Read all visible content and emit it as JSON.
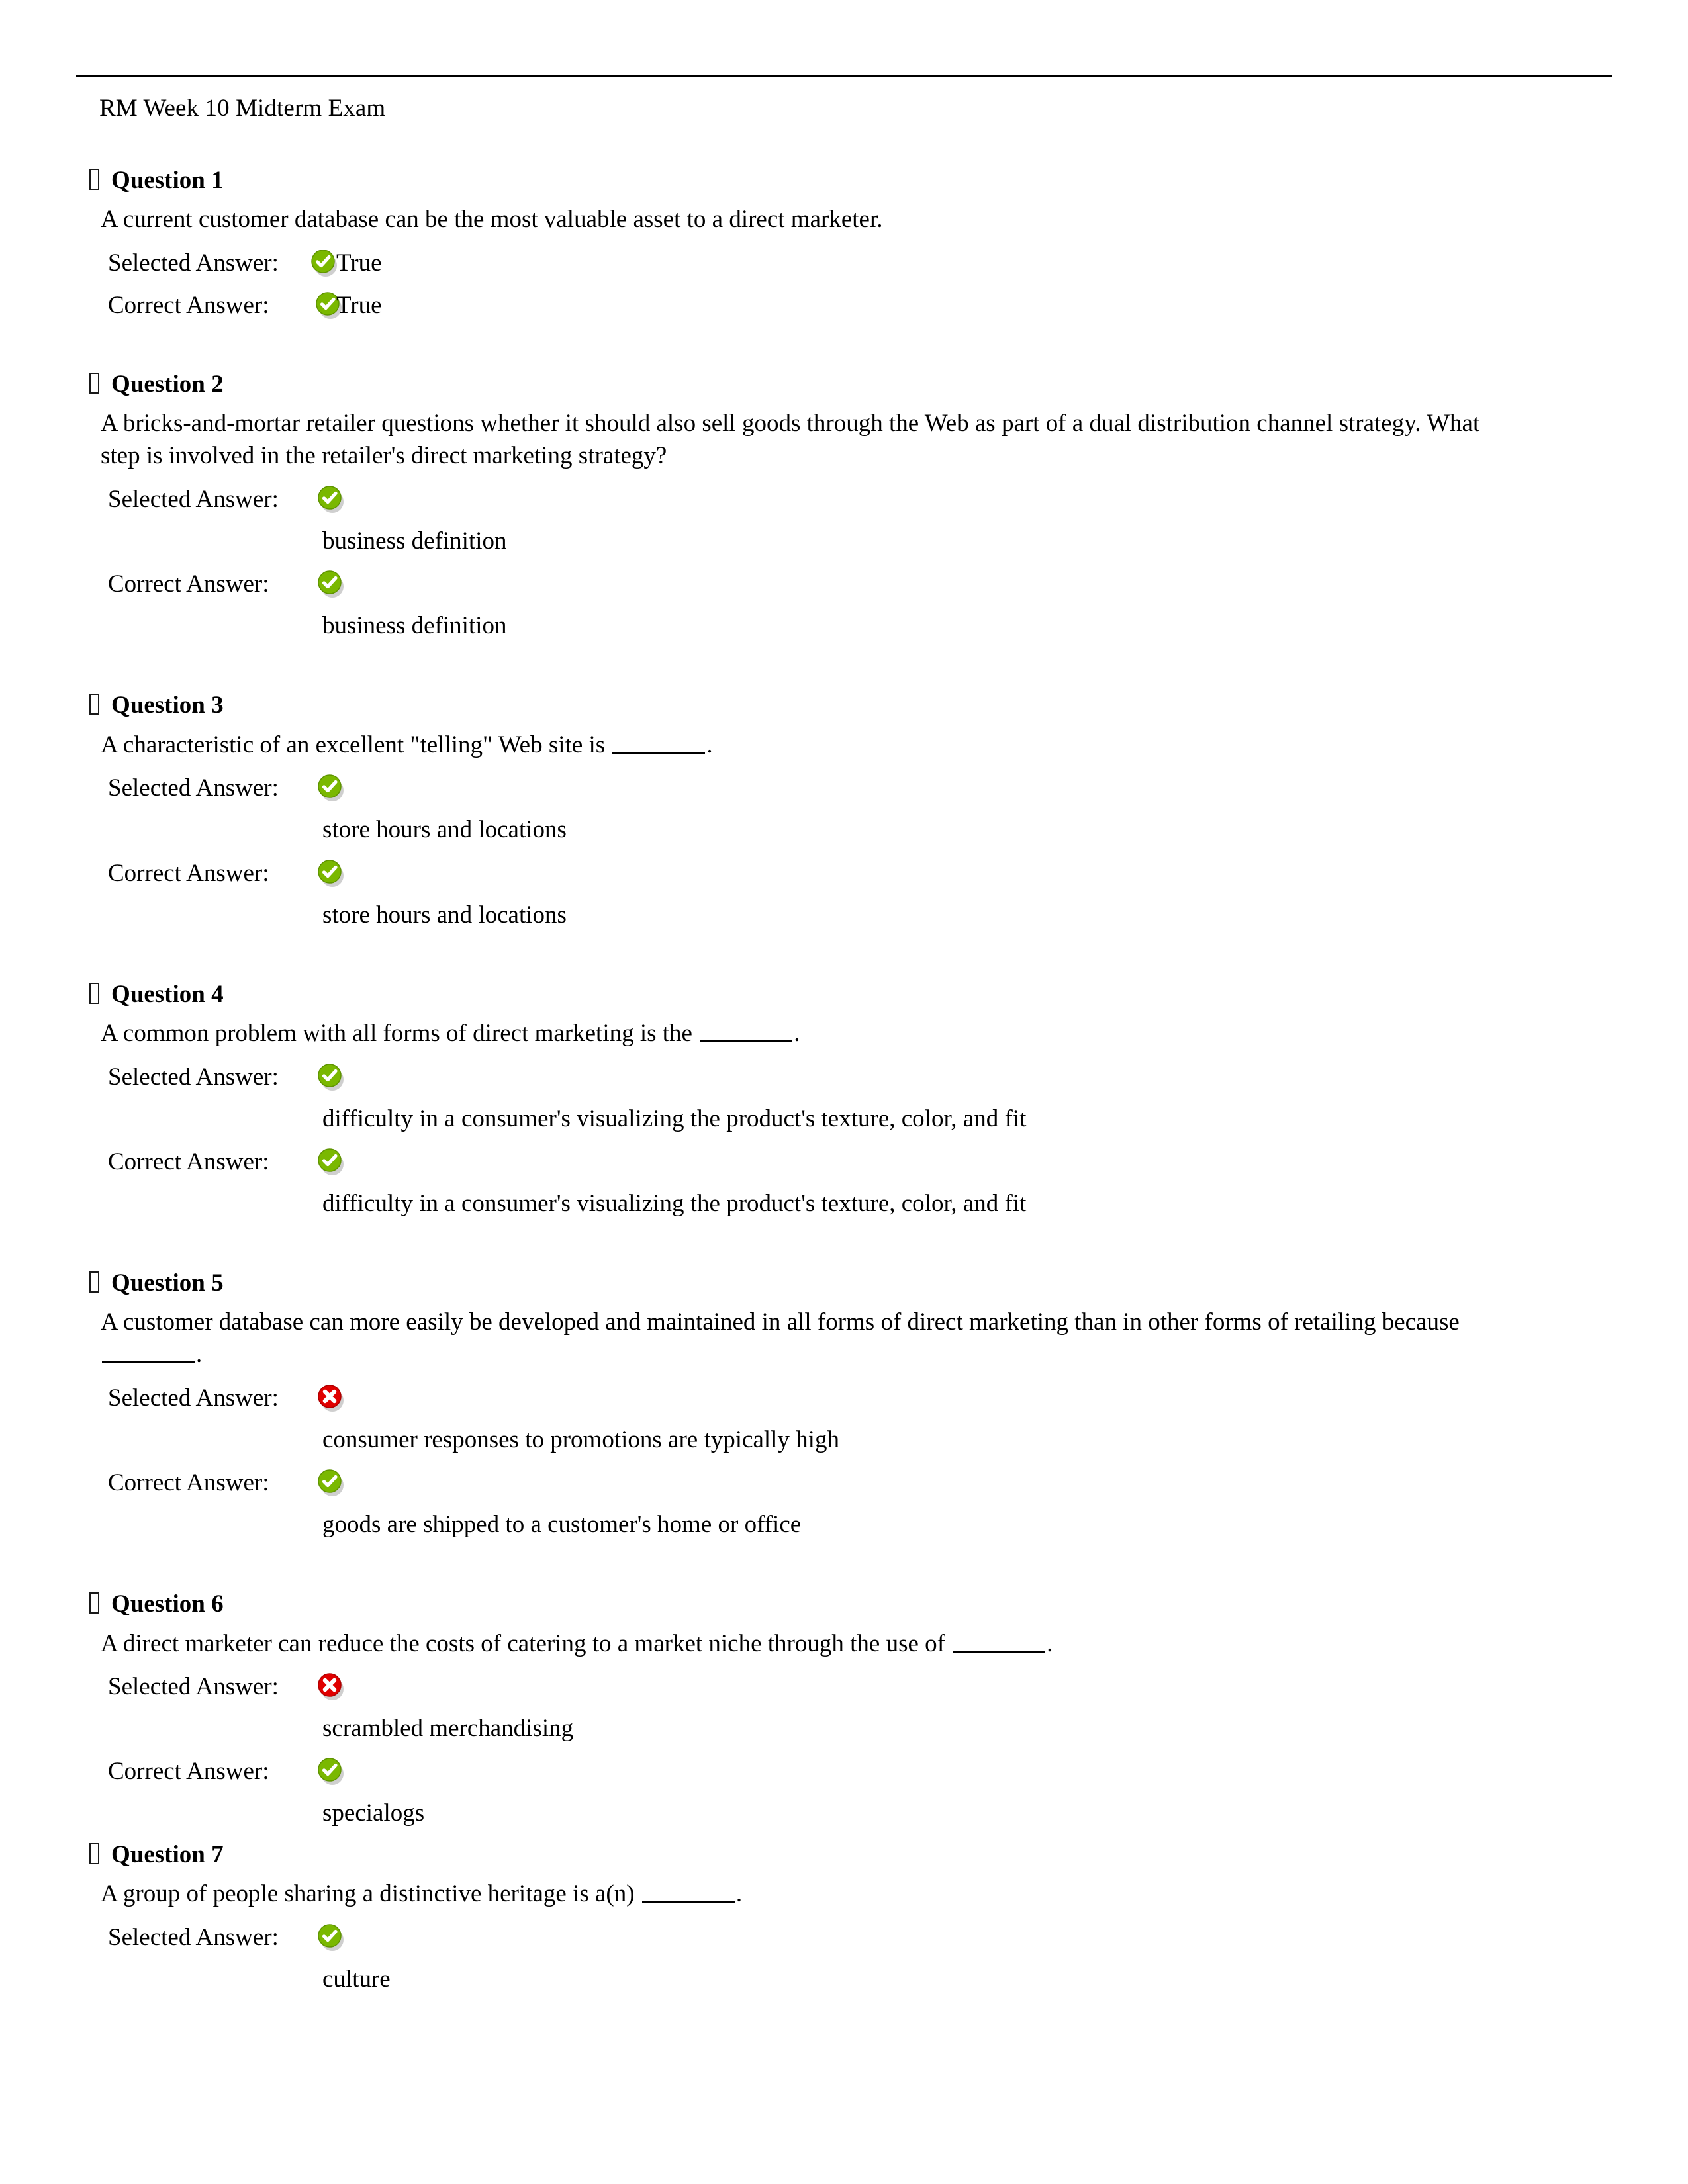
{
  "document": {
    "title": "RM Week 10 Midterm Exam",
    "labels": {
      "selected_answer": "Selected Answer:",
      "correct_answer": "Correct Answer:",
      "question_prefix": "Question"
    },
    "icons": {
      "correct": "green-check-circle-icon",
      "incorrect": "red-x-circle-icon",
      "bullet": "missing-glyph-box-icon"
    },
    "colors": {
      "correct_green": "#7ab800",
      "correct_green_dark": "#5f9400",
      "incorrect_red": "#e00000",
      "incorrect_red_dark": "#b00000",
      "icon_mark": "#ffffff",
      "text": "#000000",
      "rule": "#000000",
      "shadow": "#a8a8a8"
    }
  },
  "questions": [
    {
      "number": "Question 1",
      "text": "A current customer database can be the most valuable asset to a direct marketer.",
      "layout": "inline",
      "selected": {
        "label": "Selected Answer:",
        "value": "True",
        "status": "correct"
      },
      "correct": {
        "label": "Correct Answer:",
        "value": "True",
        "status": "correct"
      }
    },
    {
      "number": "Question 2",
      "text": "A bricks-and-mortar retailer questions whether it should also sell goods through the Web as part of a dual distribution channel strategy. What step is involved in the retailer's direct marketing strategy?",
      "layout": "wrapped",
      "selected": {
        "label": "Selected Answer:",
        "value": "business definition",
        "status": "correct"
      },
      "correct": {
        "label": "Correct Answer:",
        "value": "business definition",
        "status": "correct"
      }
    },
    {
      "number": "Question 3",
      "text_before": "A characteristic of an excellent \"telling\" Web site is ",
      "text_after": ".",
      "layout": "wrapped",
      "selected": {
        "label": "Selected Answer:",
        "value": "store hours and locations",
        "status": "correct"
      },
      "correct": {
        "label": "Correct Answer:",
        "value": "store hours and locations",
        "status": "correct"
      }
    },
    {
      "number": "Question 4",
      "text_before": "A common problem with all forms of direct marketing is the ",
      "text_after": ".",
      "layout": "wrapped",
      "selected": {
        "label": "Selected Answer:",
        "value": "difficulty in a consumer's visualizing the product's texture, color, and fit",
        "status": "correct"
      },
      "correct": {
        "label": "Correct Answer:",
        "value": "difficulty in a consumer's visualizing the product's texture, color, and fit",
        "status": "correct"
      }
    },
    {
      "number": "Question 5",
      "text_before": "A customer database can more easily be developed and maintained in all forms of direct marketing than in other forms of retailing because ",
      "text_after": ".",
      "layout": "wrapped",
      "selected": {
        "label": "Selected Answer:",
        "value": "consumer responses to promotions are typically high",
        "status": "incorrect"
      },
      "correct": {
        "label": "Correct Answer:",
        "value": "goods are shipped to a customer's home or office",
        "status": "correct"
      }
    },
    {
      "number": "Question 6",
      "text_before": "A direct marketer can reduce the costs of catering to a market niche through the use of ",
      "text_after": ".",
      "layout": "wrapped",
      "selected": {
        "label": "Selected Answer:",
        "value": "scrambled merchandising",
        "status": "incorrect"
      },
      "correct": {
        "label": "Correct Answer:",
        "value": "specialogs",
        "status": "correct"
      }
    },
    {
      "number": "Question 7",
      "text_before": "A group of people sharing a distinctive heritage is a(n) ",
      "text_after": ".",
      "layout": "wrapped",
      "selected": {
        "label": "Selected Answer:",
        "value": "culture",
        "status": "correct"
      }
    }
  ]
}
